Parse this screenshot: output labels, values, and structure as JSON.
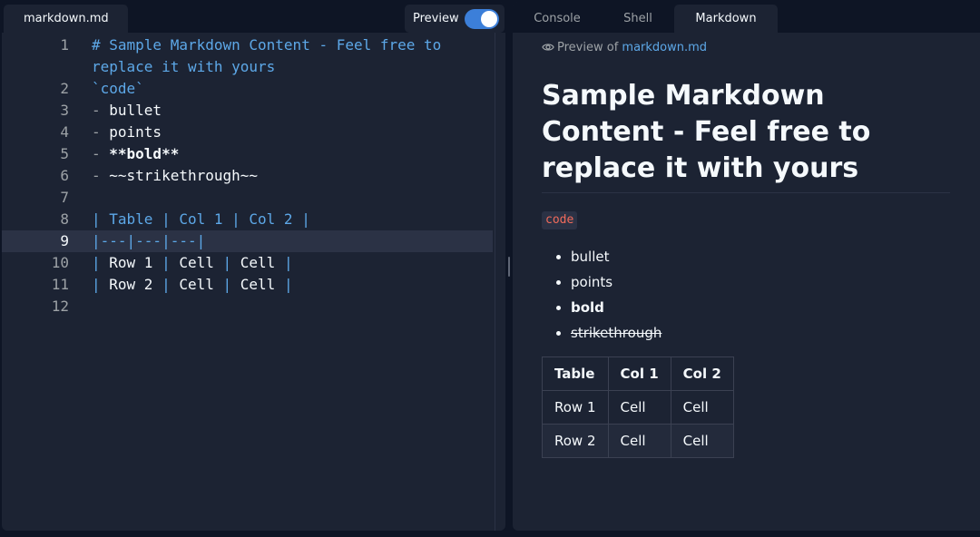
{
  "editor": {
    "file_tab": "markdown.md",
    "preview_toggle_label": "Preview",
    "preview_enabled": true,
    "lines": [
      {
        "n": "1"
      },
      {
        "n": "2"
      },
      {
        "n": "3"
      },
      {
        "n": "4"
      },
      {
        "n": "5"
      },
      {
        "n": "6"
      },
      {
        "n": "7"
      },
      {
        "n": "8"
      },
      {
        "n": "9"
      },
      {
        "n": "10"
      },
      {
        "n": "11"
      },
      {
        "n": "12"
      }
    ],
    "code": {
      "l1": "# Sample Markdown Content - Feel free to replace it with yours",
      "l2": "`code`",
      "l3_dash": "- ",
      "l3_text": "bullet",
      "l4_dash": "- ",
      "l4_text": "points",
      "l5_dash": "- ",
      "l5_text": "**bold**",
      "l6_dash": "- ",
      "l6_text": "~~strikethrough~~",
      "l8": "| Table | Col 1 | Col 2 |",
      "l9": "|---|---|---|",
      "l10_p1": "| ",
      "l10_a": "Row 1",
      "l10_p2": " | ",
      "l10_b": "Cell",
      "l10_p3": " | ",
      "l10_c": "Cell",
      "l10_p4": " |",
      "l11_p1": "| ",
      "l11_a": "Row 2",
      "l11_p2": " | ",
      "l11_b": "Cell",
      "l11_p3": " | ",
      "l11_c": "Cell",
      "l11_p4": " |"
    },
    "active_line": "9"
  },
  "tabs": [
    {
      "label": "Console"
    },
    {
      "label": "Shell"
    },
    {
      "label": "Markdown",
      "active": true
    }
  ],
  "preview": {
    "prefix": "Preview of ",
    "file_link": "markdown.md",
    "title": "Sample Markdown Content - Feel free to replace it with yours",
    "inline_code": "code",
    "list": [
      "bullet",
      "points",
      "bold",
      "strikethrough"
    ],
    "table": {
      "headers": [
        "Table",
        "Col 1",
        "Col 2"
      ],
      "rows": [
        [
          "Row 1",
          "Cell",
          "Cell"
        ],
        [
          "Row 2",
          "Cell",
          "Cell"
        ]
      ]
    }
  },
  "colors": {
    "background": "#0e1525",
    "panel": "#1c2333",
    "accent": "#3c7fd9",
    "link": "#5da8e8",
    "code_text": "#f26b5b"
  },
  "icons": [
    "eye-icon"
  ]
}
